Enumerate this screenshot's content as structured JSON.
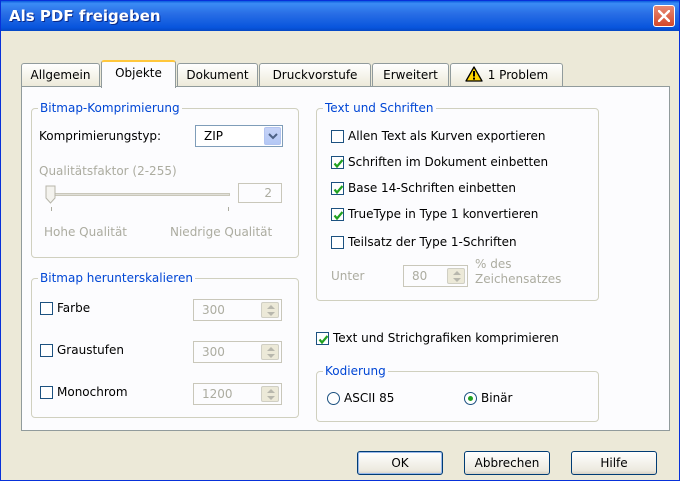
{
  "window": {
    "title": "Als PDF freigeben"
  },
  "tabs": [
    {
      "label": "Allgemein"
    },
    {
      "label": "Objekte"
    },
    {
      "label": "Dokument"
    },
    {
      "label": "Druckvorstufe"
    },
    {
      "label": "Erweitert"
    },
    {
      "label": "1 Problem",
      "icon": "warning-icon"
    }
  ],
  "bitmap_compression": {
    "legend": "Bitmap-Komprimierung",
    "type_label": "Komprimierungstyp:",
    "type_value": "ZIP",
    "quality_label": "Qualitätsfaktor (2-255)",
    "quality_value": "2",
    "high_quality_label": "Hohe Qualität",
    "low_quality_label": "Niedrige Qualität"
  },
  "bitmap_downsample": {
    "legend": "Bitmap herunterskalieren",
    "items": [
      {
        "label": "Farbe",
        "checked": false,
        "value": "300"
      },
      {
        "label": "Graustufen",
        "checked": false,
        "value": "300"
      },
      {
        "label": "Monochrom",
        "checked": false,
        "value": "1200"
      }
    ]
  },
  "text_fonts": {
    "legend": "Text und Schriften",
    "options": [
      {
        "label": "Allen Text als Kurven exportieren",
        "checked": false
      },
      {
        "label": "Schriften im Dokument einbetten",
        "checked": true
      },
      {
        "label": "Base 14-Schriften einbetten",
        "checked": true
      },
      {
        "label": "TrueType in Type 1 konvertieren",
        "checked": true
      },
      {
        "label": "Teilsatz der Type 1-Schriften",
        "checked": false
      }
    ],
    "under_label": "Unter",
    "under_value": "80",
    "percent_label_1": "% des",
    "percent_label_2": "Zeichensatzes"
  },
  "compress": {
    "label": "Text und Strichgrafiken komprimieren",
    "checked": true
  },
  "encoding": {
    "legend": "Kodierung",
    "options": [
      {
        "label": "ASCII 85",
        "selected": false
      },
      {
        "label": "Binär",
        "selected": true
      }
    ]
  },
  "buttons": {
    "ok": "OK",
    "cancel": "Abbrechen",
    "help": "Hilfe"
  },
  "colors": {
    "title_bar": "#0855dd",
    "legend_text": "#0046d5",
    "close_button": "#d4472a",
    "active_tab_accent": "#ffc73c",
    "check_mark": "#21a121"
  }
}
